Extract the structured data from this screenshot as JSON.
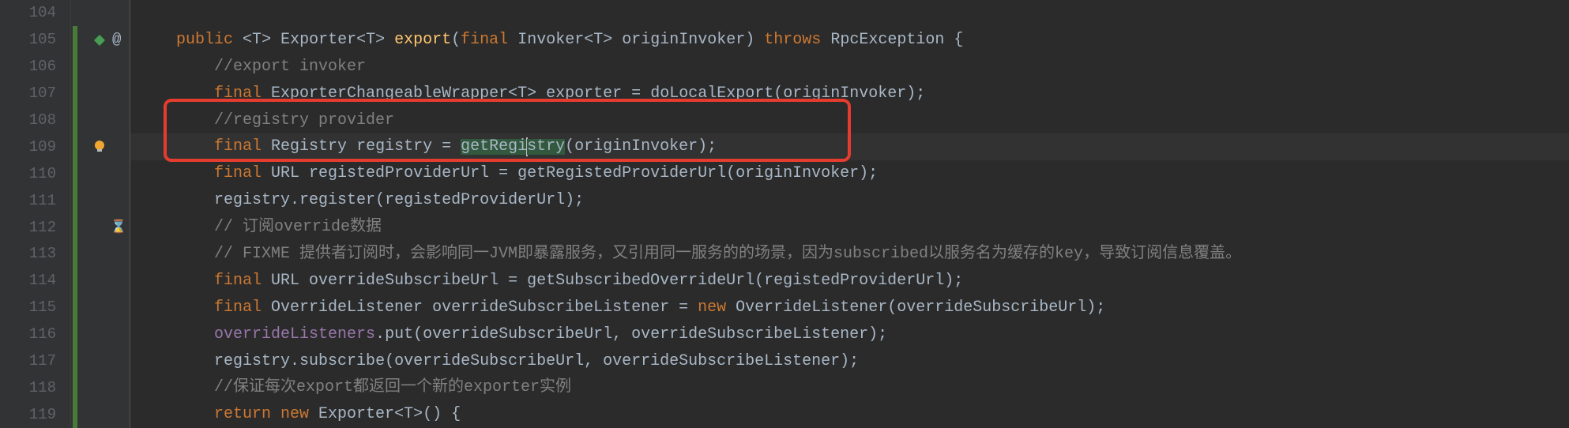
{
  "colors": {
    "keyword": "#cc7832",
    "comment": "#808080",
    "method": "#ffc66d",
    "field": "#9876aa",
    "ident": "#a9b7c6",
    "bg": "#2b2b2b",
    "gutter": "#313335",
    "lineNum": "#606366",
    "annotation": "#e43c2f"
  },
  "gutter": {
    "start": 104,
    "lines": [
      "104",
      "105",
      "106",
      "107",
      "108",
      "109",
      "110",
      "111",
      "112",
      "113",
      "114",
      "115",
      "116",
      "117",
      "118",
      "119"
    ],
    "vcs_changed_range": [
      105,
      119
    ],
    "change_marker_line": 105,
    "bulb_line": 109,
    "at_symbol_line": 105,
    "current_line": 109
  },
  "code": {
    "l104": "",
    "l105a": "    public ",
    "l105b": "<",
    "l105c": "T",
    "l105d": "> ",
    "l105e": "Exporter",
    "l105f": "<",
    "l105g": "T",
    "l105h": "> ",
    "l105i": "export",
    "l105j": "(",
    "l105k": "final ",
    "l105l": "Invoker",
    "l105m": "<",
    "l105n": "T",
    "l105o": "> ",
    "l105p": "originInvoker",
    "l105q": ") ",
    "l105r": "throws ",
    "l105s": "RpcException ",
    "l105t": "{",
    "l106": "        //export invoker",
    "l107a": "        final ",
    "l107b": "ExporterChangeableWrapper",
    "l107c": "<",
    "l107d": "T",
    "l107e": "> ",
    "l107f": "exporter ",
    "l107g": "= ",
    "l107h": "doLocalExport",
    "l107i": "(originInvoker);",
    "l108": "        //registry provider",
    "l109a": "        final ",
    "l109b": "Registry ",
    "l109c": "registry ",
    "l109d": "= ",
    "l109e": "getRegi",
    "l109f": "stry",
    "l109g": "(originInvoker);",
    "l110a": "        final ",
    "l110b": "URL ",
    "l110c": "registedProviderUrl ",
    "l110d": "= ",
    "l110e": "getRegistedProviderUrl",
    "l110f": "(originInvoker);",
    "l111a": "        registry.",
    "l111b": "register",
    "l111c": "(registedProviderUrl);",
    "l112": "        // 订阅override数据",
    "l113": "        // FIXME 提供者订阅时，会影响同一JVM即暴露服务，又引用同一服务的的场景，因为subscribed以服务名为缓存的key，导致订阅信息覆盖。",
    "l114a": "        final ",
    "l114b": "URL ",
    "l114c": "overrideSubscribeUrl ",
    "l114d": "= ",
    "l114e": "getSubscribedOverrideUrl",
    "l114f": "(registedProviderUrl);",
    "l115a": "        final ",
    "l115b": "OverrideListener ",
    "l115c": "overrideSubscribeListener ",
    "l115d": "= ",
    "l115e": "new ",
    "l115f": "OverrideListener",
    "l115g": "(overrideSubscribeUrl);",
    "l116a": "        ",
    "l116b": "overrideListeners",
    "l116c": ".put(overrideSubscribeUrl, overrideSubscribeListener);",
    "l117a": "        registry.",
    "l117b": "subscribe",
    "l117c": "(overrideSubscribeUrl, overrideSubscribeListener);",
    "l118": "        //保证每次export都返回一个新的exporter实例",
    "l119a": "        return new ",
    "l119b": "Exporter",
    "l119c": "<",
    "l119d": "T",
    "l119e": ">() {"
  },
  "icons": {
    "bulb": "bulb-icon",
    "diamond": "change-diamond-icon",
    "vcs": "vcs-change-marker"
  },
  "annotation": {
    "highlight_box_lines": [
      108,
      109
    ]
  }
}
